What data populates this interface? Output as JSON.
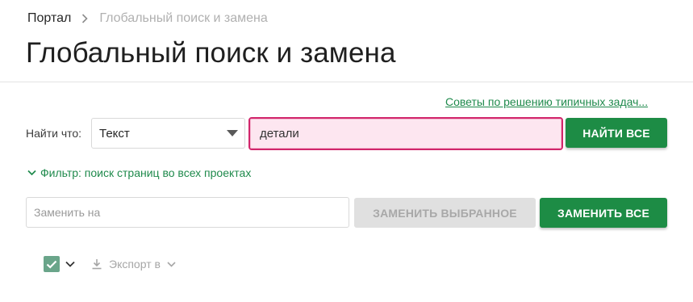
{
  "breadcrumb": {
    "root": "Портал",
    "current": "Глобальный поиск и замена"
  },
  "page": {
    "title": "Глобальный поиск и замена"
  },
  "tips_link": "Советы по решению типичных задач...",
  "find": {
    "label": "Найти что:",
    "type_selected": "Текст",
    "query": "детали",
    "button": "НАЙТИ ВСЕ"
  },
  "filter": {
    "label": "Фильтр: поиск страниц во всех проектах"
  },
  "replace": {
    "placeholder": "Заменить на",
    "value": "",
    "selected_button": "ЗАМЕНИТЬ ВЫБРАННОЕ",
    "all_button": "ЗАМЕНИТЬ ВСЕ"
  },
  "toolbar": {
    "export_label": "Экспорт в"
  },
  "icons": {
    "breadcrumb_separator": "chevron-right-icon",
    "select_caret": "caret-down-icon",
    "filter_toggle": "chevron-down-icon",
    "select_all": "check-icon",
    "export": "download-icon"
  },
  "colors": {
    "accent_green": "#1d8c45",
    "link_green": "#1f8a4c",
    "search_highlight_border": "#d1266b",
    "search_highlight_bg": "#fde6f0",
    "checkbox_green": "#6aa58a",
    "disabled_bg": "#e0e0e0"
  }
}
